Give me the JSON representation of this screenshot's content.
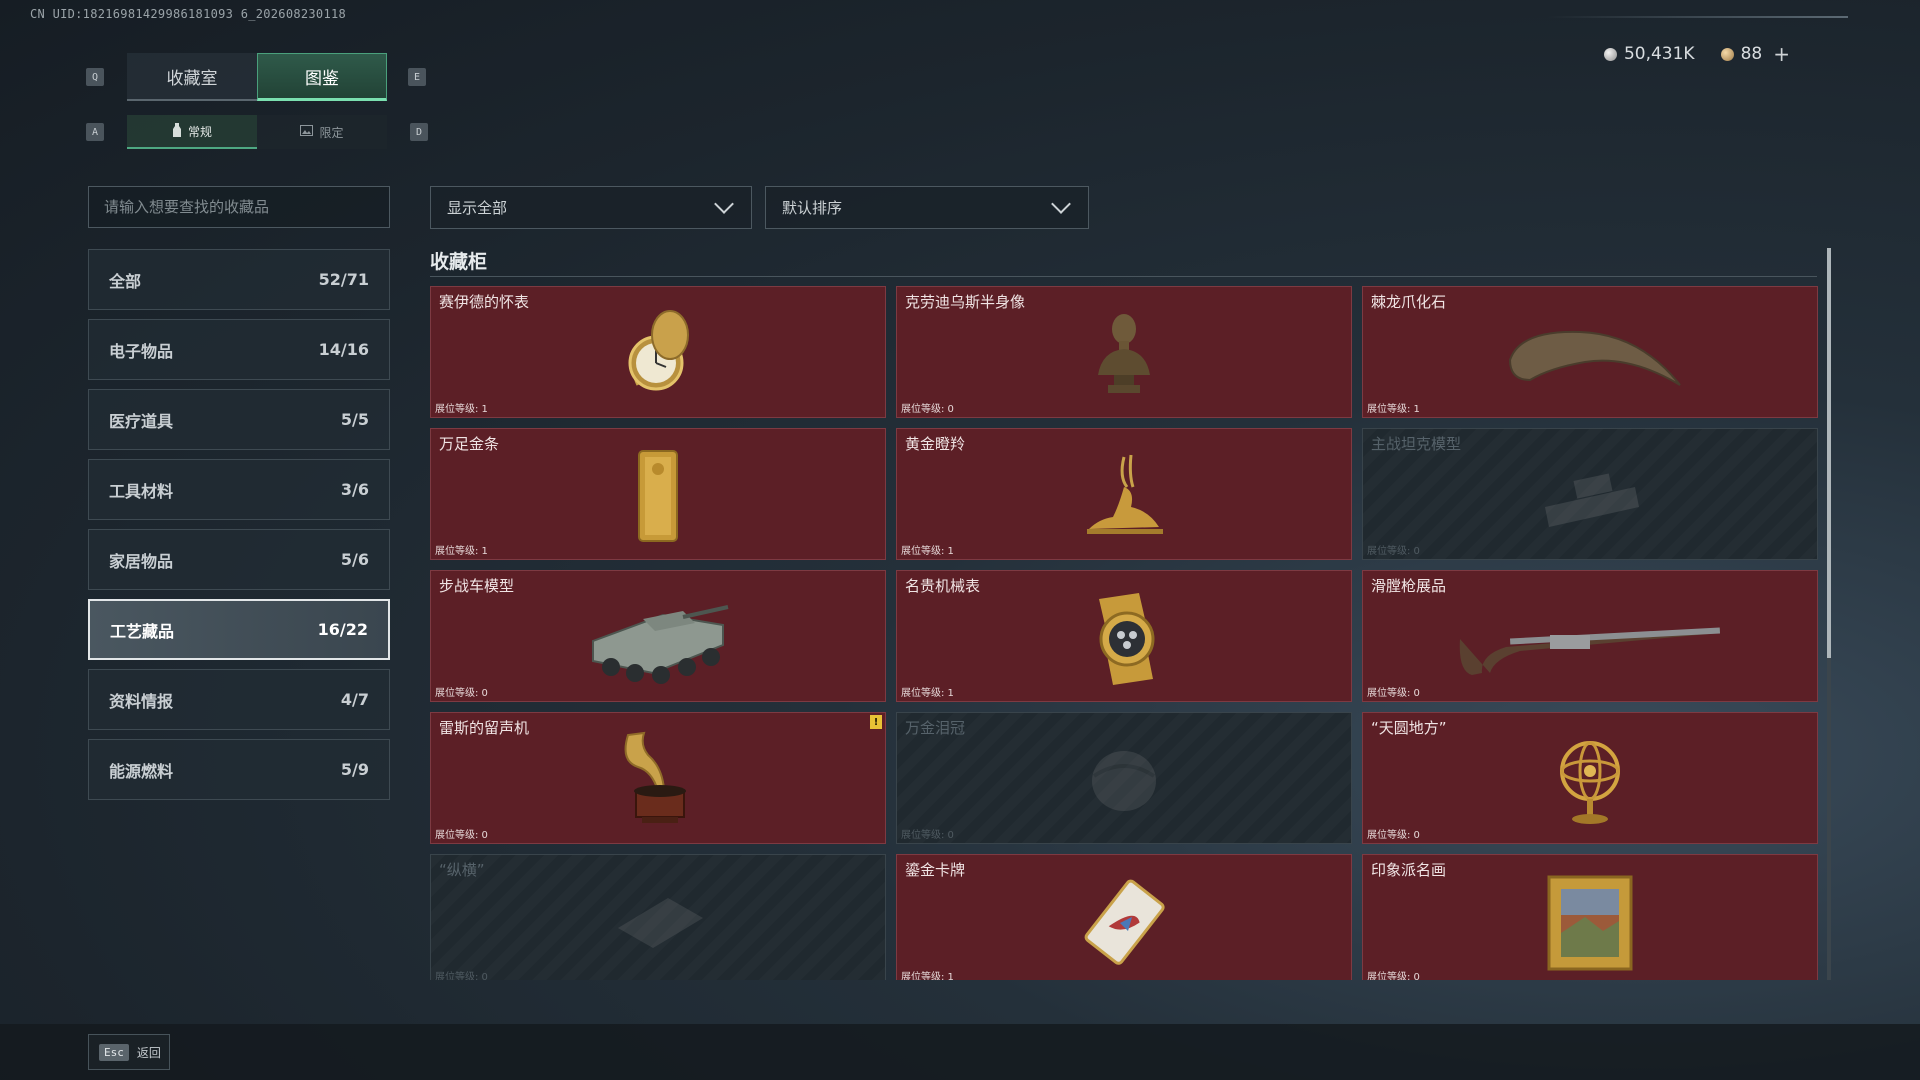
{
  "header": {
    "uid": "CN UID:18216981429986181093 6_202608230118",
    "currency": [
      {
        "icon": "silver-coin-icon",
        "value": "50,431K"
      },
      {
        "icon": "gold-coin-icon",
        "value": "88"
      }
    ],
    "add_label": "+"
  },
  "keys": {
    "prev_tab": "Q",
    "next_tab": "E",
    "prev_sub": "A",
    "next_sub": "D"
  },
  "tabs": [
    {
      "label": "收藏室",
      "active": false
    },
    {
      "label": "图鉴",
      "active": true
    }
  ],
  "subtabs": [
    {
      "label": "常规",
      "icon": "bottle-icon",
      "active": true
    },
    {
      "label": "限定",
      "icon": "image-icon",
      "active": false
    }
  ],
  "search": {
    "placeholder": "请输入想要查找的收藏品"
  },
  "categories": [
    {
      "label": "全部",
      "count": "52/71"
    },
    {
      "label": "电子物品",
      "count": "14/16"
    },
    {
      "label": "医疗道具",
      "count": "5/5"
    },
    {
      "label": "工具材料",
      "count": "3/6"
    },
    {
      "label": "家居物品",
      "count": "5/6"
    },
    {
      "label": "工艺藏品",
      "count": "16/22",
      "active": true
    },
    {
      "label": "资料情报",
      "count": "4/7"
    },
    {
      "label": "能源燃料",
      "count": "5/9"
    }
  ],
  "filters": {
    "show": "显示全部",
    "sort": "默认排序"
  },
  "section": {
    "title": "收藏柜"
  },
  "items": [
    {
      "name": "赛伊德的怀表",
      "level": "展位等级: 1",
      "icon": "pocket-watch-icon",
      "locked": false
    },
    {
      "name": "克劳迪乌斯半身像",
      "level": "展位等级: 0",
      "icon": "bust-icon",
      "locked": false
    },
    {
      "name": "棘龙爪化石",
      "level": "展位等级: 1",
      "icon": "claw-fossil-icon",
      "locked": false
    },
    {
      "name": "万足金条",
      "level": "展位等级: 1",
      "icon": "gold-bar-icon",
      "locked": false
    },
    {
      "name": "黄金瞪羚",
      "level": "展位等级: 1",
      "icon": "gazelle-icon",
      "locked": false
    },
    {
      "name": "主战坦克模型",
      "level": "展位等级: 0",
      "icon": "tank-icon",
      "locked": true
    },
    {
      "name": "步战车模型",
      "level": "展位等级: 0",
      "icon": "ifv-icon",
      "locked": false
    },
    {
      "name": "名贵机械表",
      "level": "展位等级: 1",
      "icon": "wristwatch-icon",
      "locked": false
    },
    {
      "name": "滑膛枪展品",
      "level": "展位等级: 0",
      "icon": "musket-icon",
      "locked": false
    },
    {
      "name": "雷斯的留声机",
      "level": "展位等级: 0",
      "icon": "gramophone-icon",
      "locked": false,
      "badge": "!"
    },
    {
      "name": "万金泪冠",
      "level": "展位等级: 0",
      "icon": "crown-icon",
      "locked": true
    },
    {
      "name": "“天圆地方”",
      "level": "展位等级: 0",
      "icon": "armillary-icon",
      "locked": false
    },
    {
      "name": "“纵横”",
      "level": "展位等级: 0",
      "icon": "chessboard-icon",
      "locked": true
    },
    {
      "name": "鎏金卡牌",
      "level": "展位等级: 1",
      "icon": "card-icon",
      "locked": false
    },
    {
      "name": "印象派名画",
      "level": "展位等级: 0",
      "icon": "painting-icon",
      "locked": false
    }
  ],
  "footer": {
    "esc_key": "Esc",
    "back_label": "返回"
  }
}
